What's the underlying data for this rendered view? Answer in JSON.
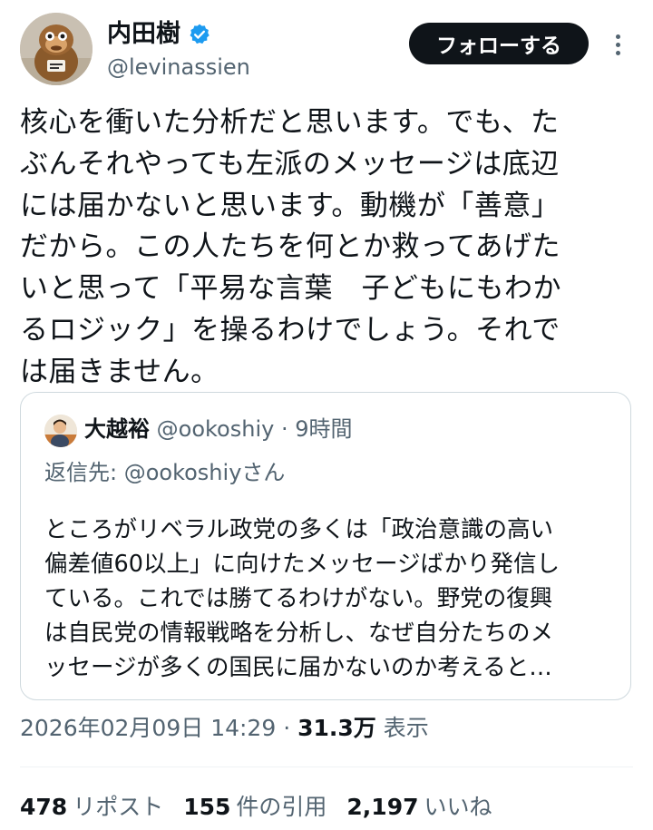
{
  "author": {
    "display_name": "内田樹",
    "handle": "@levinassien",
    "verified": true
  },
  "follow_button": "フォローする",
  "more_icon": "more-vertical-icon",
  "tweet_text": "核心を衝いた分析だと思います。でも、た\nぶんそれやっても左派のメッセージは底辺\nには届かないと思います。動機が「善意」\nだから。この人たちを何とか救ってあげた\nいと思って「平易な言葉　子どもにもわか\nるロジック」を操るわけでしょう。それで\nは届きません。",
  "quote": {
    "display_name": "大越裕",
    "handle": "@ookoshiy",
    "time": "· 9時間",
    "reply_to": "返信先: @ookoshiyさん",
    "text": "ところがリベラル政党の多くは「政治意識の高い\n偏差値60以上」に向けたメッセージばかり発信し\nている。これでは勝てるわけがない。野党の復興\nは自民党の情報戦略を分析し、なぜ自分たちのメ\nッセージが多くの国民に届かないのか考えると…"
  },
  "meta": {
    "timestamp": "2026年02月09日 14:29",
    "separator": "·",
    "views_count": "31.3万",
    "views_label": "表示"
  },
  "stats": [
    {
      "count": "478",
      "label": "リポスト"
    },
    {
      "count": "155",
      "label": "件の引用"
    },
    {
      "count": "2,197",
      "label": "いいね"
    }
  ],
  "colors": {
    "text": "#0f1419",
    "secondary": "#536471",
    "verified": "#1d9bf0",
    "border": "#cfd9de"
  }
}
